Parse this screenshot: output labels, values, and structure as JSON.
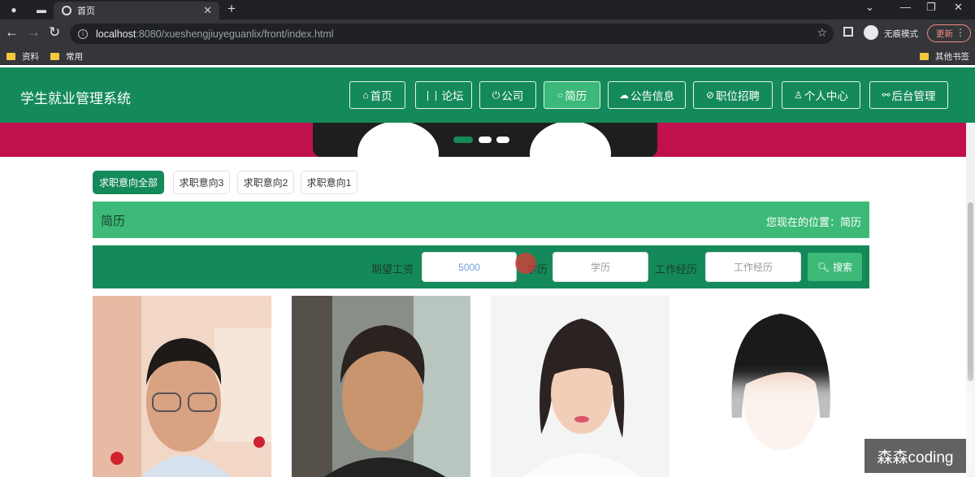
{
  "browser": {
    "tab_title": "首页",
    "url_host": "localhost",
    "url_rest": ":8080/xueshengjiuyeguanlix/front/index.html",
    "incognito_label": "无痕模式",
    "update_label": "更新",
    "bookmarks": [
      "资料",
      "常用"
    ],
    "other_bookmarks": "其他书签"
  },
  "site": {
    "title": "学生就业管理系统",
    "nav": [
      {
        "label": "首页",
        "icon": "home-icon"
      },
      {
        "label": "论坛",
        "icon": "forum-icon"
      },
      {
        "label": "公司",
        "icon": "power-icon"
      },
      {
        "label": "简历",
        "icon": "chat-icon",
        "active": true
      },
      {
        "label": "公告信息",
        "icon": "cloud-icon"
      },
      {
        "label": "职位招聘",
        "icon": "link-icon"
      },
      {
        "label": "个人中心",
        "icon": "user-icon"
      },
      {
        "label": "后台管理",
        "icon": "link-icon"
      }
    ]
  },
  "filters": [
    "求职意向全部",
    "求职意向3",
    "求职意向2",
    "求职意向1"
  ],
  "page": {
    "title": "简历",
    "location": "您现在的位置：简历"
  },
  "search": {
    "salary_label": "期望工资",
    "salary_value": "5000",
    "education_label": "学历",
    "education_placeholder": "学历",
    "experience_label": "工作经历",
    "experience_placeholder": "工作经历",
    "button_label": "搜索"
  },
  "watermark": "森森coding",
  "colors": {
    "primary": "#148a5a",
    "accent": "#3dba78",
    "banner": "#c0104e"
  }
}
